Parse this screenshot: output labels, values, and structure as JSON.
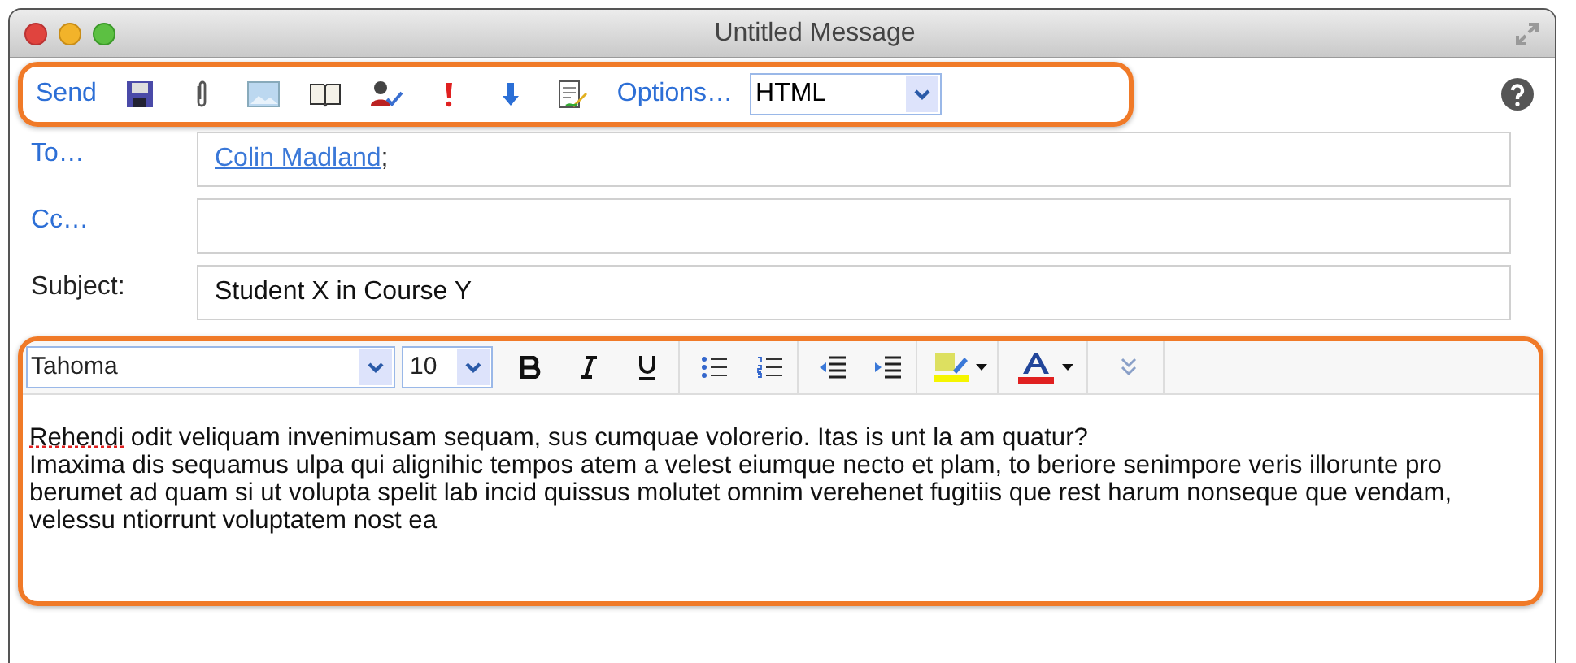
{
  "window": {
    "title": "Untitled Message"
  },
  "toolbar": {
    "send": "Send",
    "options": "Options…",
    "format": "HTML"
  },
  "fields": [
    {
      "label": "To…",
      "kind": "link",
      "recipients": [
        "Colin Madland"
      ],
      "separator": ";"
    },
    {
      "label": "Cc…",
      "kind": "link"
    },
    {
      "label": "Subject:",
      "kind": "plain",
      "value": "Student X in Course Y"
    }
  ],
  "editor": {
    "font": "Tahoma",
    "size": "10",
    "paragraphs": [
      [
        {
          "text": "Rehendi",
          "misspelled": true
        },
        {
          "text": " odit veliquam invenimusam sequam, sus cumquae volorerio. Itas is unt la am quatur?",
          "misspelled": false
        }
      ],
      [
        {
          "text": "Imaxima dis sequamus ulpa qui alignihic tempos atem a velest eiumque necto et plam, to beriore senimpore veris illorunte pro berumet ad quam si ut volupta spelit lab incid quissus molutet omnim verehenet fugitiis que rest harum nonseque que vendam, velessu ntiorrunt voluptatem nost ea",
          "misspelled": false
        }
      ]
    ]
  }
}
